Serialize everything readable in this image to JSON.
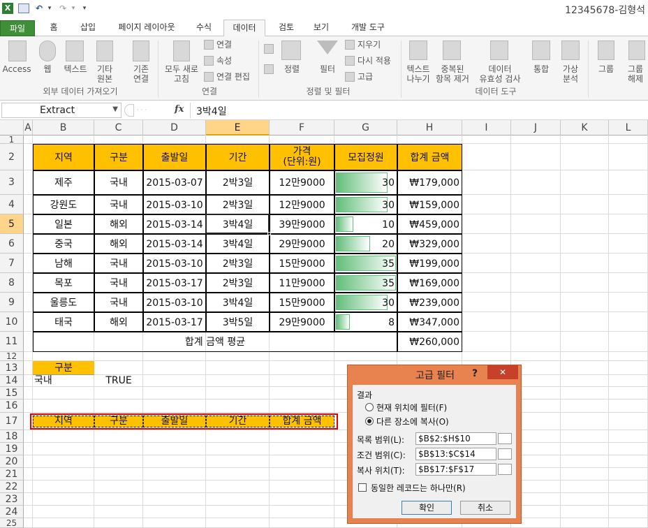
{
  "window": {
    "title": "12345678-김형석"
  },
  "quick_access": {
    "excel_icon": "X",
    "save_icon": "save-icon",
    "undo_icon": "↶",
    "redo_icon": "↷",
    "customize": "▾"
  },
  "tabs": [
    "파일",
    "홈",
    "삽입",
    "페이지 레이아웃",
    "수식",
    "데이터",
    "검토",
    "보기",
    "개발 도구"
  ],
  "ribbon": {
    "ext": {
      "access": "Access",
      "web": "웹",
      "text": "텍스트",
      "other1": "기타",
      "other2": "원본",
      "group": "외부 데이터 가져오기"
    },
    "conn": {
      "existing1": "기존",
      "existing2": "연결",
      "refresh1": "모두 새로",
      "refresh2": "고침",
      "connections": "연결",
      "properties": "속성",
      "edit_links": "연결 편집",
      "group": "연결"
    },
    "sort": {
      "sort": "정렬",
      "filter": "필터",
      "clear": "지우기",
      "reapply": "다시 적용",
      "advanced": "고급",
      "group": "정렬 및 필터"
    },
    "tools": {
      "t2c1": "텍스트",
      "t2c2": "나누기",
      "dup1": "중복된",
      "dup2": "항목 제거",
      "val1": "데이터",
      "val2": "유효성 검사",
      "consolidate": "통합",
      "whatif1": "가상",
      "whatif2": "분석",
      "group": "데이터 도구"
    },
    "outline": {
      "group_btn": "그룹",
      "ungroup1": "그룹",
      "ungroup2": "해제"
    }
  },
  "formula_bar": {
    "name_box": "Extract",
    "fx": "fx",
    "formula": "3박4일"
  },
  "columns": [
    "A",
    "B",
    "C",
    "D",
    "E",
    "F",
    "G",
    "H",
    "I",
    "J",
    "K",
    "L"
  ],
  "rows": [
    "1",
    "2",
    "3",
    "4",
    "5",
    "6",
    "7",
    "8",
    "9",
    "10",
    "11",
    "12",
    "13",
    "14",
    "15",
    "16",
    "17",
    "18",
    "19",
    "20",
    "21",
    "22",
    "23",
    "24",
    "25"
  ],
  "table": {
    "headers": [
      "지역",
      "구분",
      "출발일",
      "기간",
      "가격",
      "(단위:원)",
      "모집정원",
      "합계 금액"
    ],
    "data": [
      [
        "제주",
        "국내",
        "2015-03-07",
        "2박3일",
        "12만9000",
        "30",
        "₩179,000"
      ],
      [
        "강원도",
        "국내",
        "2015-03-10",
        "2박3일",
        "12만9000",
        "30",
        "₩159,000"
      ],
      [
        "일본",
        "해외",
        "2015-03-14",
        "3박4일",
        "39만9000",
        "10",
        "₩459,000"
      ],
      [
        "중국",
        "해외",
        "2015-03-14",
        "3박4일",
        "29만9000",
        "20",
        "₩329,000"
      ],
      [
        "남해",
        "국내",
        "2015-03-10",
        "2박3일",
        "15만9000",
        "35",
        "₩199,000"
      ],
      [
        "목포",
        "국내",
        "2015-03-17",
        "2박3일",
        "11만9000",
        "35",
        "₩169,000"
      ],
      [
        "울릉도",
        "국내",
        "2015-03-10",
        "3박4일",
        "15만9000",
        "30",
        "₩239,000"
      ],
      [
        "태국",
        "해외",
        "2015-03-17",
        "3박5일",
        "29만9000",
        "8",
        "₩347,000"
      ]
    ],
    "databar_fraction": [
      0.857,
      0.857,
      0.286,
      0.571,
      1.0,
      1.0,
      0.857,
      0.229
    ],
    "avg_label": "합계 금액 평균",
    "avg_value": "₩260,000"
  },
  "criteria": {
    "header": "구분",
    "value": "국내",
    "formula_result": "TRUE"
  },
  "extract_headers": [
    "지역",
    "구분",
    "출발일",
    "기간",
    "합계 금액"
  ],
  "dialog": {
    "title": "고급 필터",
    "help": "?",
    "close": "✕",
    "result_label": "결과",
    "opt_inplace": "현재 위치에 필터(F)",
    "opt_copy": "다른 장소에 복사(O)",
    "list_label": "목록 범위(L):",
    "list_value": "$B$2:$H$10",
    "criteria_label": "조건 범위(C):",
    "criteria_value": "$B$13:$C$14",
    "copyto_label": "복사 위치(T):",
    "copyto_value": "$B$17:$F$17",
    "unique_label": "동일한 레코드는 하나만(R)",
    "ok": "확인",
    "cancel": "취소"
  },
  "colors": {
    "header_fill": "#ffc000",
    "databar": "#63be7b",
    "file_tab": "#3f8f39",
    "dialog_frame": "#e8834f",
    "selection": "#ffd58a",
    "extract_box": "#e00000"
  }
}
